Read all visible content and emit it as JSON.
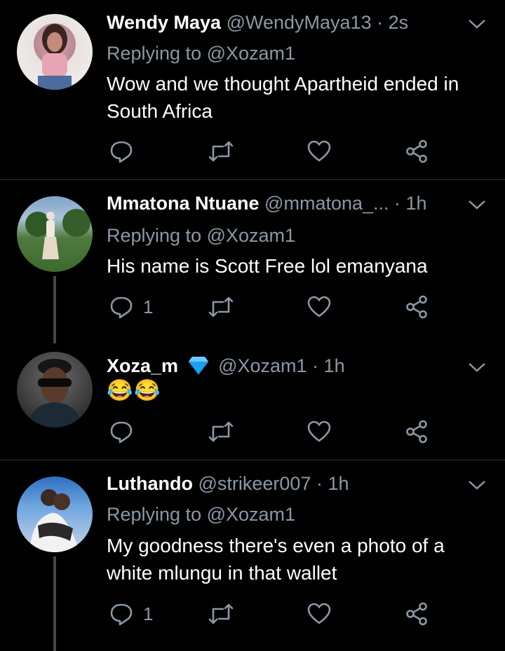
{
  "tweets": [
    {
      "name": "Wendy Maya",
      "handle": "@WendyMaya13",
      "time": "· 2s",
      "replying_label": "Replying to",
      "replying_to": "@Xozam1",
      "text": "Wow and we thought Apartheid  ended in South Africa",
      "reply_count": ""
    },
    {
      "name": "Mmatona Ntuane",
      "handle": "@mmatona_...",
      "time": "· 1h",
      "replying_label": "Replying to",
      "replying_to": "@Xozam1",
      "text": "His name is Scott Free lol emanyana",
      "reply_count": "1"
    },
    {
      "name": "Xoza_m",
      "handle": "@Xozam1",
      "time": "· 1h",
      "verified_icon": "blue-diamond-icon",
      "text": "😂😂",
      "reply_count": ""
    },
    {
      "name": "Luthando",
      "handle": "@strikeer007",
      "time": "· 1h",
      "replying_label": "Replying to",
      "replying_to": "@Xozam1",
      "text": "My goodness there's even a photo of a white mlungu in that wallet",
      "reply_count": "1"
    }
  ],
  "colors": {
    "background": "#000000",
    "secondary": "#8b98a5",
    "divider": "#2f3336",
    "verified": "#1da1f2"
  }
}
